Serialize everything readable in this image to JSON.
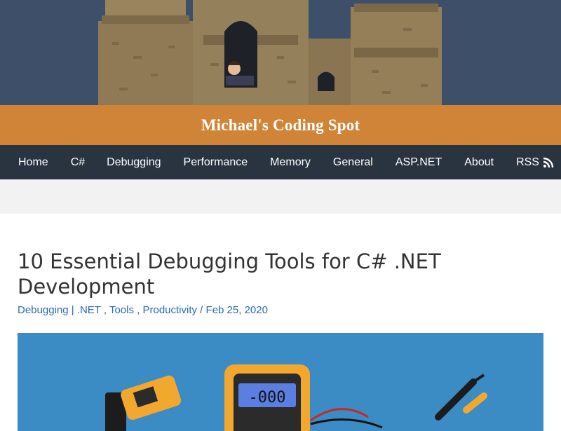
{
  "site": {
    "title": "Michael's Coding Spot"
  },
  "nav": {
    "items": [
      {
        "label": "Home"
      },
      {
        "label": "C#"
      },
      {
        "label": "Debugging"
      },
      {
        "label": "Performance"
      },
      {
        "label": "Memory"
      },
      {
        "label": "General"
      },
      {
        "label": "ASP.NET"
      },
      {
        "label": "About"
      },
      {
        "label": "RSS",
        "icon": "rss-icon"
      }
    ]
  },
  "post": {
    "title_line1": "10 Essential Debugging Tools for C# .NET",
    "title_line2": "Development",
    "meta": {
      "category": "Debugging",
      "sep1": " | ",
      "tag1": ".NET",
      "sep2": " , ",
      "tag2": "Tools",
      "sep3": " , ",
      "tag3": "Productivity",
      "sep4": " / ",
      "date": "Feb 25, 2020"
    }
  },
  "featured_image": {
    "multimeter_display": "-000",
    "subject": "measuring tools illustration"
  },
  "colors": {
    "header_bg": "#3e4f6a",
    "title_bar": "#cf8437",
    "nav_bg": "#2a3441",
    "link": "#2a6cae",
    "featured_bg": "#3b8bc4"
  }
}
